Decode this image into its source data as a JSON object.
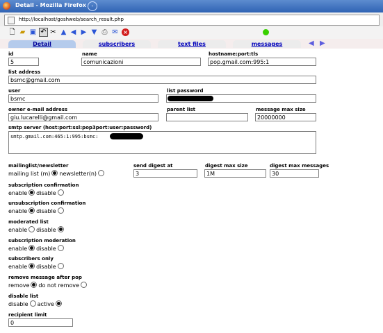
{
  "window": {
    "title": "Detail - Mozilla Firefox",
    "title_icon": "firefox-icon"
  },
  "urlbar": {
    "url": "http://localhost/goshweb/search_result.php"
  },
  "toolbar": {
    "icons": [
      "new-document-icon",
      "open-folder-icon",
      "save-icon",
      "undo-icon",
      "cut-icon",
      "up-arrow-icon",
      "left-arrow-icon",
      "right-arrow-icon",
      "down-arrow-icon",
      "print-icon",
      "mail-icon",
      "close-icon"
    ],
    "status_color": "#39d000"
  },
  "tabs": [
    {
      "label": "Detail",
      "active": true
    },
    {
      "label": "subscribers"
    },
    {
      "label": "text files"
    },
    {
      "label": "messages"
    }
  ],
  "fields": {
    "id": {
      "label": "id",
      "value": "5"
    },
    "name": {
      "label": "name",
      "value": "comunicazioni"
    },
    "hostname": {
      "label": "hostname:port:tls",
      "value": "pop.gmail.com:995:1"
    },
    "list_address": {
      "label": "list address",
      "value": "bsmc@gmail.com"
    },
    "user": {
      "label": "user",
      "value": "bsmc"
    },
    "list_password": {
      "label": "list password",
      "value": ""
    },
    "owner_email": {
      "label": "owner e-mail address",
      "value": "giu.lucarelli@gmail.com"
    },
    "parent_list": {
      "label": "parent list",
      "value": ""
    },
    "message_max_size": {
      "label": "message max size",
      "value": "20000000"
    },
    "smtp_server": {
      "label": "smtp server (host:port:ssl:pop3port:user:password)",
      "value": "smtp.gmail.com:465:1:995:bsmc:"
    },
    "send_digest_at": {
      "label": "send digest at",
      "value": "3"
    },
    "digest_max_size": {
      "label": "digest max size",
      "value": "1M"
    },
    "digest_max_messages": {
      "label": "digest max messages",
      "value": "30"
    },
    "recipient_limit": {
      "label": "recipient limit",
      "value": "0"
    }
  },
  "radios": {
    "mailinglist": {
      "label": "mailinglist/newsletter",
      "opt1": "mailing list (m)",
      "opt2": "newsletter(n)"
    },
    "subscription_confirmation": {
      "label": "subscription confirmation",
      "opt1": "enable",
      "opt2": "disable"
    },
    "unsubscription_confirmation": {
      "label": "unsubscription confirmation",
      "opt1": "enable",
      "opt2": "disable"
    },
    "moderated_list": {
      "label": "moderated list",
      "opt1": "enable",
      "opt2": "disable"
    },
    "subscription_moderation": {
      "label": "subscription moderation",
      "opt1": "enable",
      "opt2": "disable"
    },
    "subscribers_only": {
      "label": "subscribers only",
      "opt1": "enable",
      "opt2": "disable"
    },
    "remove_after_pop": {
      "label": "remove message after pop",
      "opt1": "remove",
      "opt2": "do not remove"
    },
    "disable_list": {
      "label": "disable list",
      "opt1": "disable",
      "opt2": "active"
    }
  }
}
